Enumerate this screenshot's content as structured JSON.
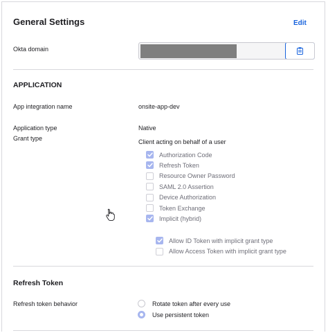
{
  "header": {
    "title": "General Settings",
    "edit_label": "Edit"
  },
  "okta_domain": {
    "label": "Okta domain"
  },
  "application": {
    "section_title": "APPLICATION",
    "app_integration_name": {
      "label": "App integration name",
      "value": "onsite-app-dev"
    },
    "application_type": {
      "label": "Application type",
      "value": "Native"
    },
    "grant_type": {
      "label": "Grant type",
      "subtitle": "Client acting on behalf of a user",
      "options": [
        {
          "label": "Authorization Code",
          "checked": true
        },
        {
          "label": "Refresh Token",
          "checked": true
        },
        {
          "label": "Resource Owner Password",
          "checked": false
        },
        {
          "label": "SAML 2.0 Assertion",
          "checked": false
        },
        {
          "label": "Device Authorization",
          "checked": false
        },
        {
          "label": "Token Exchange",
          "checked": false
        },
        {
          "label": "Implicit (hybrid)",
          "checked": true
        }
      ],
      "implicit_options": [
        {
          "label": "Allow ID Token with implicit grant type",
          "checked": true
        },
        {
          "label": "Allow Access Token with implicit grant type",
          "checked": false
        }
      ]
    }
  },
  "refresh_token": {
    "section_title": "Refresh Token",
    "behavior": {
      "label": "Refresh token behavior",
      "options": [
        {
          "label": "Rotate token after every use",
          "selected": false
        },
        {
          "label": "Use persistent token",
          "selected": true
        }
      ]
    }
  },
  "colors": {
    "accent": "#1662dd",
    "checked": "#a7b6ef",
    "divider": "#d7d7dc"
  }
}
